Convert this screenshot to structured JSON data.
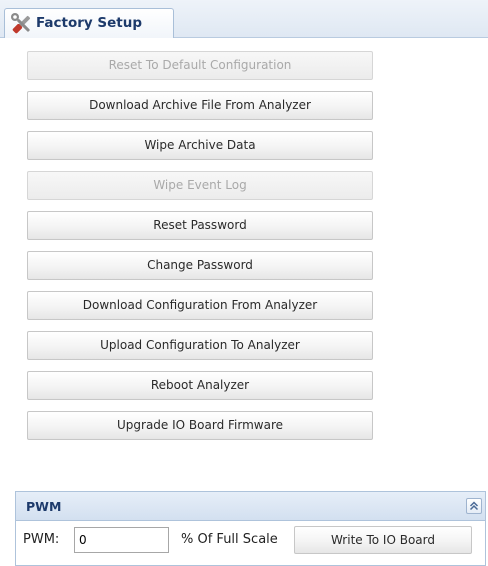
{
  "tab": {
    "title": "Factory Setup",
    "icon": "wrench-screwdriver-icon"
  },
  "buttons": [
    {
      "label": "Reset To Default Configuration",
      "enabled": false
    },
    {
      "label": "Download Archive File From Analyzer",
      "enabled": true
    },
    {
      "label": "Wipe Archive Data",
      "enabled": true
    },
    {
      "label": "Wipe Event Log",
      "enabled": false
    },
    {
      "label": "Reset Password",
      "enabled": true
    },
    {
      "label": "Change Password",
      "enabled": true
    },
    {
      "label": "Download Configuration From Analyzer",
      "enabled": true
    },
    {
      "label": "Upload Configuration To Analyzer",
      "enabled": true
    },
    {
      "label": "Reboot Analyzer",
      "enabled": true
    },
    {
      "label": "Upgrade IO Board Firmware",
      "enabled": true
    }
  ],
  "pwm": {
    "title": "PWM",
    "collapse_icon": "double-chevron-up-icon",
    "label": "PWM:",
    "value": "0",
    "unit_label": "% Of Full Scale",
    "write_label": "Write To IO Board"
  },
  "colors": {
    "header_text": "#1d3a6b",
    "panel_border": "#aec3db",
    "disabled_text": "#a9a9a9"
  }
}
